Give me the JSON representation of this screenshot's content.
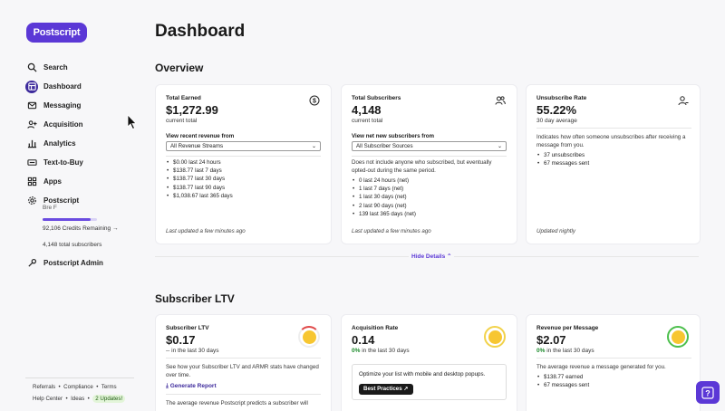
{
  "sidebar": {
    "logo": "Postscript",
    "nav": [
      {
        "label": "Search",
        "icon": "search-icon"
      },
      {
        "label": "Dashboard",
        "icon": "dashboard-icon",
        "active": true
      },
      {
        "label": "Messaging",
        "icon": "messaging-icon"
      },
      {
        "label": "Acquisition",
        "icon": "acquisition-icon"
      },
      {
        "label": "Analytics",
        "icon": "analytics-icon"
      },
      {
        "label": "Text-to-Buy",
        "icon": "text-to-buy-icon"
      },
      {
        "label": "Apps",
        "icon": "apps-icon"
      },
      {
        "label": "Postscript",
        "icon": "settings-icon"
      }
    ],
    "shop_user": "Bre F",
    "credit_fraction": 0.88,
    "credits_remaining": "92,106 Credits Remaining →",
    "total_subscribers": "4,148 total subscribers",
    "admin": "Postscript Admin",
    "footer_links_1": [
      "Referrals",
      "Compliance",
      "Terms"
    ],
    "footer_links_2": [
      "Help Center",
      "Ideas"
    ],
    "updates_badge": "2 Updates!"
  },
  "main": {
    "title": "Dashboard",
    "overview_title": "Overview",
    "hide_details": "Hide Details",
    "ltv_title": "Subscriber LTV"
  },
  "overview": {
    "earned": {
      "label": "Total Earned",
      "value": "$1,272.99",
      "sub": "current total",
      "field_label": "View recent revenue from",
      "select": "All Revenue Streams",
      "items": [
        "$0.00 last 24 hours",
        "$138.77 last 7 days",
        "$138.77 last 30 days",
        "$138.77 last 90 days",
        "$1,038.67 last 365 days"
      ],
      "updated": "Last updated a few minutes ago"
    },
    "subscribers": {
      "label": "Total Subscribers",
      "value": "4,148",
      "sub": "current total",
      "field_label": "View net new subscribers from",
      "select": "All Subscriber Sources",
      "desc": "Does not include anyone who subscribed, but eventually opted-out during the same period.",
      "items": [
        "0 last 24 hours (net)",
        "1 last 7 days (net)",
        "1 last 30 days (net)",
        "2 last 90 days (net)",
        "139 last 365 days (net)"
      ],
      "updated": "Last updated a few minutes ago"
    },
    "unsubscribe": {
      "label": "Unsubscribe Rate",
      "value": "55.22%",
      "sub": "30 day average",
      "desc": "Indicates how often someone unsubscribes after receiving a message from you.",
      "items": [
        "37 unsubscribes",
        "67 messages sent"
      ],
      "updated": "Updated nightly"
    }
  },
  "ltv": {
    "ltv": {
      "label": "Subscriber LTV",
      "value": "$0.17",
      "sub": "-- in the last 30 days",
      "desc": "See how your Subscriber LTV and ARMR stats have changed over time.",
      "link": "Generate Report",
      "desc2": "The average revenue Postscript predicts a subscriber will"
    },
    "acquisition": {
      "label": "Acquisition Rate",
      "value": "0.14",
      "sub_pct": "0%",
      "sub_rest": " in the last 30 days",
      "tip": "Optimize your list with mobile and desktop popups.",
      "tip_button": "Best Practices"
    },
    "revenue": {
      "label": "Revenue per Message",
      "value": "$2.07",
      "sub_pct": "0%",
      "sub_rest": " in the last 30 days",
      "desc": "The average revenue a message generated for you.",
      "items": [
        "$138.77 earned",
        "67 messages sent"
      ]
    }
  },
  "colors": {
    "brand": "#5b38d6",
    "active": "#3d2a9c",
    "positive": "#1a8a2a"
  }
}
